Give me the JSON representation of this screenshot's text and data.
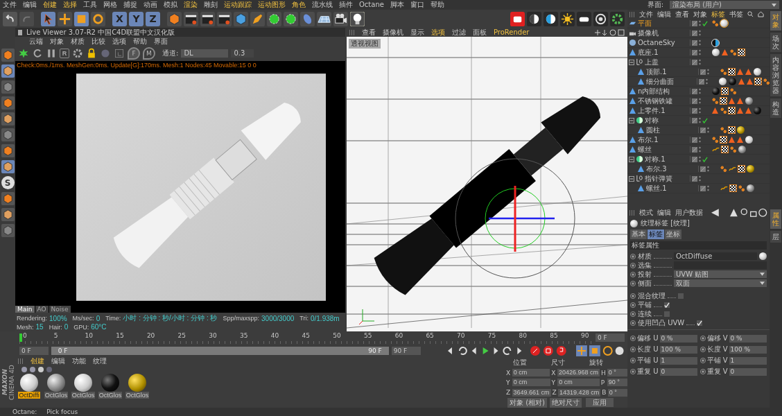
{
  "menu_bar": {
    "items": [
      {
        "label": "文件",
        "highlighted": false
      },
      {
        "label": "编辑",
        "highlighted": false
      },
      {
        "label": "创建",
        "highlighted": true
      },
      {
        "label": "选择",
        "highlighted": true
      },
      {
        "label": "工具",
        "highlighted": false
      },
      {
        "label": "网格",
        "highlighted": false
      },
      {
        "label": "捕捉",
        "highlighted": false
      },
      {
        "label": "动画",
        "highlighted": false
      },
      {
        "label": "模拟",
        "highlighted": false
      },
      {
        "label": "渲染",
        "highlighted": true
      },
      {
        "label": "雕刻",
        "highlighted": false
      },
      {
        "label": "运动跟踪",
        "highlighted": true
      },
      {
        "label": "运动图形",
        "highlighted": true
      },
      {
        "label": "角色",
        "highlighted": true
      },
      {
        "label": "流水线",
        "highlighted": false
      },
      {
        "label": "插件",
        "highlighted": false
      },
      {
        "label": "Octane",
        "highlighted": false
      },
      {
        "label": "脚本",
        "highlighted": false
      },
      {
        "label": "窗口",
        "highlighted": false
      },
      {
        "label": "帮助",
        "highlighted": false
      }
    ],
    "layout_label": "界面:",
    "layout_value": "渲染布局 (用户)"
  },
  "toolbar": {
    "axes": [
      {
        "letter": "X",
        "selected": true
      },
      {
        "letter": "Y",
        "selected": true
      },
      {
        "letter": "Z",
        "selected": true
      }
    ]
  },
  "left_toolbar": {
    "letter_tool": "S"
  },
  "live_viewer": {
    "title": "Live Viewer 3.07-R2 中国C4D联盟中文汉化版",
    "menu": [
      "云端",
      "对象",
      "材质",
      "比较",
      "选项",
      "帮助",
      "界面"
    ],
    "reset_letter": "R",
    "pins": [
      {
        "letter": "F",
        "selected": true
      },
      {
        "letter": "M",
        "selected": false
      }
    ],
    "channel_label": "通道:",
    "channel_value": "DL",
    "value": "0.3",
    "stats": "Check:0ms./1ms. MeshGen:0ms. Update[G]:170ms. Mesh:1 Nodes:45 Movable:15  0 0",
    "tabs": [
      {
        "label": "Main",
        "selected": true
      },
      {
        "label": "AO",
        "selected": false
      },
      {
        "label": "Noise",
        "selected": false
      }
    ],
    "status": [
      {
        "label": "Rendering:",
        "value": "100%"
      },
      {
        "label": "Ms/sec:",
        "value": "0"
      },
      {
        "label": "Time:",
        "value": "小时 : 分钟 : 秒/小时 : 分钟 : 秒"
      },
      {
        "label": "Spp/maxspp:",
        "value": "3000/3000"
      },
      {
        "label": "Tri:",
        "value": "0/1.938m"
      },
      {
        "label": "Mesh:",
        "value": "15"
      },
      {
        "label": "Hair:",
        "value": "0"
      },
      {
        "label": "GPU:",
        "value": "60°C"
      }
    ]
  },
  "viewport": {
    "menu": [
      {
        "label": "查看",
        "highlighted": false
      },
      {
        "label": "摄像机",
        "highlighted": false
      },
      {
        "label": "显示",
        "highlighted": false
      },
      {
        "label": "选项",
        "highlighted": true
      },
      {
        "label": "过滤",
        "highlighted": false
      },
      {
        "label": "面板",
        "highlighted": false
      },
      {
        "label": "ProRender",
        "highlighted": true
      }
    ],
    "view_label": "透视视图"
  },
  "object_manager": {
    "menu": [
      {
        "label": "文件",
        "selected": false
      },
      {
        "label": "编辑",
        "selected": false
      },
      {
        "label": "查看",
        "selected": false
      },
      {
        "label": "对象",
        "selected": false
      },
      {
        "label": "标签",
        "selected": true
      },
      {
        "label": "书签",
        "selected": false
      }
    ],
    "objects": [
      {
        "name": "平面",
        "kind": "plane",
        "selected": true,
        "checked": true,
        "tags": [
          {
            "kind": "dots"
          },
          {
            "kind": "sphere-white",
            "selected": true
          }
        ]
      },
      {
        "name": "摄像机",
        "kind": "camera",
        "selected": false,
        "checked": false
      },
      {
        "name": "OctaneSky",
        "kind": "sky",
        "selected": false,
        "checked": false,
        "tags": [
          {
            "kind": "sky"
          }
        ]
      },
      {
        "name": "底座.1",
        "kind": "mesh",
        "selected": false,
        "checked": false,
        "tags": [
          {
            "kind": "sphere-white"
          },
          {
            "kind": "cone"
          },
          {
            "kind": "dots"
          },
          {
            "kind": "checker"
          }
        ]
      },
      {
        "name": "上盖",
        "kind": "null",
        "selected": false,
        "checked": false,
        "expanded": true,
        "children": [
          {
            "name": "顶部.1",
            "kind": "mesh",
            "selected": false,
            "checked": false,
            "tags": [
              {
                "kind": "dots"
              },
              {
                "kind": "checker"
              },
              {
                "kind": "cone"
              },
              {
                "kind": "cone"
              },
              {
                "kind": "sphere-white"
              }
            ]
          },
          {
            "name": "细分曲面",
            "kind": "mesh",
            "selected": false,
            "checked": false,
            "tags": [
              {
                "kind": "sphere-white"
              },
              {
                "kind": "sphere-black"
              },
              {
                "kind": "cone"
              },
              {
                "kind": "cone"
              },
              {
                "kind": "checker"
              },
              {
                "kind": "dots"
              }
            ]
          }
        ]
      },
      {
        "name": "n内部结构",
        "kind": "mesh",
        "selected": false,
        "checked": false,
        "tags": [
          {
            "kind": "sphere-black"
          },
          {
            "kind": "checker"
          },
          {
            "kind": "dots"
          }
        ]
      },
      {
        "name": "不锈钢铁罐",
        "kind": "mesh",
        "selected": false,
        "checked": false,
        "tags": [
          {
            "kind": "dots"
          },
          {
            "kind": "checker"
          },
          {
            "kind": "cone"
          },
          {
            "kind": "cone"
          },
          {
            "kind": "sphere-gray"
          }
        ]
      },
      {
        "name": "上零件.1",
        "kind": "mesh",
        "selected": false,
        "checked": false,
        "tags": [
          {
            "kind": "cone"
          },
          {
            "kind": "dots"
          },
          {
            "kind": "checker"
          },
          {
            "kind": "cone"
          },
          {
            "kind": "cone"
          },
          {
            "kind": "sphere-black"
          }
        ]
      },
      {
        "name": "对称",
        "kind": "symmetry",
        "selected": false,
        "checked": true,
        "expanded": true,
        "children": [
          {
            "name": "圆柱",
            "kind": "mesh",
            "selected": false,
            "checked": false,
            "tags": [
              {
                "kind": "dots"
              },
              {
                "kind": "checker"
              },
              {
                "kind": "sphere-gold"
              }
            ]
          }
        ]
      },
      {
        "name": "布尔.1",
        "kind": "mesh",
        "selected": false,
        "checked": false,
        "tags": [
          {
            "kind": "dots"
          },
          {
            "kind": "checker"
          },
          {
            "kind": "cone"
          },
          {
            "kind": "cone"
          },
          {
            "kind": "sphere-white"
          }
        ]
      },
      {
        "name": "螺丝",
        "kind": "mesh",
        "selected": false,
        "checked": false,
        "tags": [
          {
            "kind": "bend"
          },
          {
            "kind": "checker"
          },
          {
            "kind": "dots"
          },
          {
            "kind": "sphere-gray"
          }
        ]
      },
      {
        "name": "对称.1",
        "kind": "symmetry",
        "selected": false,
        "checked": true,
        "expanded": true,
        "children": [
          {
            "name": "布尔.3",
            "kind": "mesh",
            "selected": false,
            "checked": false,
            "tags": [
              {
                "kind": "dots"
              },
              {
                "kind": "bend"
              },
              {
                "kind": "checker"
              },
              {
                "kind": "sphere-gold"
              }
            ]
          }
        ]
      },
      {
        "name": "指针弹簧",
        "kind": "null",
        "selected": false,
        "checked": false,
        "expanded": true,
        "children": [
          {
            "name": "螺丝.1",
            "kind": "mesh",
            "selected": false,
            "checked": false,
            "tags": [
              {
                "kind": "bend"
              },
              {
                "kind": "checker"
              },
              {
                "kind": "dots"
              },
              {
                "kind": "sphere-gray"
              }
            ]
          }
        ]
      }
    ],
    "side_tabs": [
      {
        "label": "对象",
        "selected": true
      },
      {
        "label": "场次",
        "selected": false
      },
      {
        "label": "内容浏览器",
        "selected": false
      },
      {
        "label": "构造",
        "selected": false
      }
    ]
  },
  "attributes": {
    "menu": [
      "模式",
      "编辑",
      "用户数据"
    ],
    "title": "纹理标签 [纹理]",
    "tabs": [
      {
        "label": "基本",
        "selected": false
      },
      {
        "label": "标签",
        "selected": true
      },
      {
        "label": "坐标",
        "selected": false
      }
    ],
    "section": "标签属性",
    "fields": [
      {
        "kind": "material",
        "label": "材质",
        "value": "OctDiffuse"
      },
      {
        "kind": "field",
        "label": "选集"
      },
      {
        "kind": "dropdown",
        "label": "投射",
        "value": "UVW 贴图"
      },
      {
        "kind": "dropdown",
        "label": "侧面",
        "value": "双面"
      },
      {
        "kind": "checkbox",
        "label": "混合纹理",
        "checked": false
      },
      {
        "kind": "checkbox",
        "label": "平铺",
        "checked": true
      },
      {
        "kind": "checkbox",
        "label": "连续",
        "checked": false
      },
      {
        "kind": "checkbox",
        "label": "使用凹凸 UVW",
        "checked": true
      }
    ],
    "uv_fields": [
      {
        "label": "偏移 U",
        "value": "0 %"
      },
      {
        "label": "偏移 V",
        "value": "0 %"
      },
      {
        "label": "长度 U",
        "value": "100 %"
      },
      {
        "label": "长度 V",
        "value": "100 %"
      },
      {
        "label": "平铺 U",
        "value": "1"
      },
      {
        "label": "平铺 V",
        "value": "1"
      },
      {
        "label": "重复 U",
        "value": "0"
      },
      {
        "label": "重复 V",
        "value": "0"
      }
    ],
    "side_tabs": [
      {
        "label": "属性",
        "selected": true
      },
      {
        "label": "层",
        "selected": false
      }
    ]
  },
  "timeline": {
    "ticks": [
      "0",
      "5",
      "10",
      "15",
      "20",
      "25",
      "30",
      "35",
      "40",
      "45",
      "50",
      "55",
      "60",
      "65",
      "70",
      "75",
      "80",
      "85",
      "90"
    ],
    "current_frame": "0 F",
    "start": "0 F",
    "range": {
      "start": "0 F",
      "end": "90 F",
      "level": 1
    },
    "end": "90 F"
  },
  "materials": {
    "menu": [
      {
        "label": "创建",
        "selected": true
      },
      {
        "label": "编辑",
        "selected": false
      },
      {
        "label": "功能",
        "selected": false
      },
      {
        "label": "纹理",
        "selected": false
      }
    ],
    "items": [
      {
        "name": "OctDiffi",
        "kind": "white",
        "selected": true
      },
      {
        "name": "OctGlos",
        "kind": "gray",
        "selected": false
      },
      {
        "name": "OctGlos",
        "kind": "white",
        "selected": false
      },
      {
        "name": "OctGlos",
        "kind": "black",
        "selected": false
      },
      {
        "name": "OctGlos",
        "kind": "gold",
        "selected": false
      }
    ]
  },
  "logo": {
    "brand": "MAXON",
    "product": "CINEMA 4D"
  },
  "coordinates": {
    "headers": [
      "位置",
      "尺寸",
      "旋转"
    ],
    "rows": [
      {
        "axis": "X",
        "position": "0 cm",
        "size_axis": "X",
        "size": "20426.968 cm",
        "rot_axis": "H",
        "rotation": "0 °"
      },
      {
        "axis": "Y",
        "position": "0 cm",
        "size_axis": "Y",
        "size": "0 cm",
        "rot_axis": "P",
        "rotation": "90 °"
      },
      {
        "axis": "Z",
        "position": "3649.661 cm",
        "size_axis": "Z",
        "size": "14319.428 cm",
        "rot_axis": "B",
        "rotation": "0 °"
      }
    ],
    "mode": "对象 (相对)",
    "size_mode": "绝对尺寸",
    "apply": "应用"
  },
  "status_bar": {
    "label": "Octane:",
    "message": "Pick focus"
  }
}
